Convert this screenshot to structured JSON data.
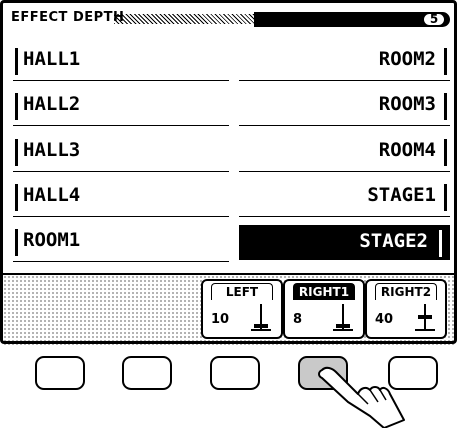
{
  "header": {
    "title": "EFFECT DEPTH",
    "page": "5"
  },
  "effects": {
    "left": [
      "HALL1",
      "HALL2",
      "HALL3",
      "HALL4",
      "ROOM1"
    ],
    "right": [
      "ROOM2",
      "ROOM3",
      "ROOM4",
      "STAGE1",
      "STAGE2"
    ],
    "selected": "STAGE2"
  },
  "tabs": [
    {
      "title": "LEFT",
      "value": "10",
      "level": 10
    },
    {
      "title": "RIGHT1",
      "value": "8",
      "level": 8
    },
    {
      "title": "RIGHT2",
      "value": "40",
      "level": 40
    }
  ],
  "panel_buttons": {
    "count": 5,
    "pressed_index": 3
  },
  "colors": {
    "lcd_fg": "#000000",
    "lcd_bg": "#ffffff",
    "pressed_button": "#c9c9c9"
  },
  "icons": [
    "fader-icon",
    "pointing-hand-icon"
  ]
}
